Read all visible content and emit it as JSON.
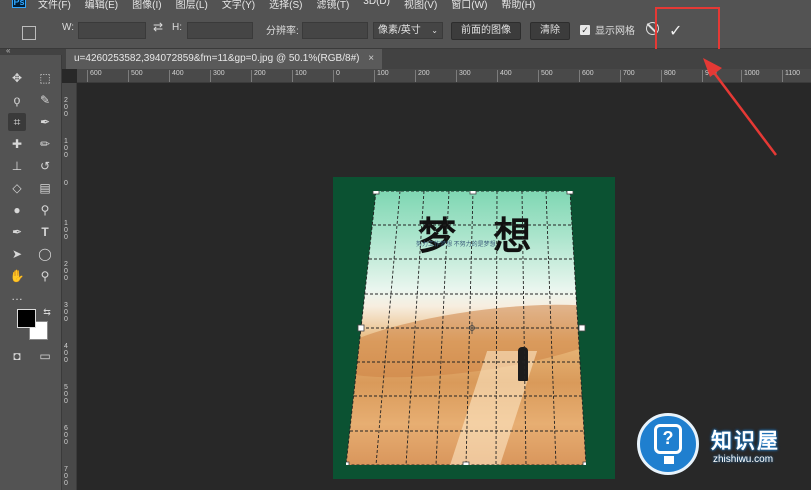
{
  "menubar": {
    "logo": "Ps",
    "items": [
      "文件(F)",
      "编辑(E)",
      "图像(I)",
      "图层(L)",
      "文字(Y)",
      "选择(S)",
      "滤镜(T)",
      "3D(D)",
      "视图(V)",
      "窗口(W)",
      "帮助(H)"
    ]
  },
  "options": {
    "w_label": "W:",
    "h_label": "H:",
    "swap_icon": "⇄",
    "resolution_label": "分辨率:",
    "unit_select": "像素/英寸",
    "front_image_button": "前面的图像",
    "clear_button": "清除",
    "show_grid_label": "显示网格",
    "show_grid_checked": true,
    "cancel_icon": "cancel-icon",
    "confirm_icon": "✓"
  },
  "document": {
    "tab_title": "u=4260253582,394072859&fm=11&gp=0.jpg @ 50.1%(RGB/8#)",
    "tab_close": "×",
    "poster_title": "梦 想",
    "poster_subtitle": "努力工作梦想   不努力的是梦想"
  },
  "rulers": {
    "horizontal": [
      "600",
      "500",
      "400",
      "300",
      "200",
      "100",
      "0",
      "100",
      "200",
      "300",
      "400",
      "500",
      "600",
      "700",
      "800",
      "900",
      "1000",
      "1100"
    ],
    "vertical": [
      "2 0 0",
      "1 0 0",
      "0",
      "1 0 0",
      "2 0 0",
      "3 0 0",
      "4 0 0",
      "5 0 0",
      "6 0 0",
      "7 0 0"
    ]
  },
  "toolbar": {
    "collapse": "«",
    "tools": [
      {
        "name": "move-tool",
        "glyph": "✥"
      },
      {
        "name": "marquee-tool",
        "glyph": "⬚"
      },
      {
        "name": "lasso-tool",
        "glyph": "ϙ"
      },
      {
        "name": "quick-select-tool",
        "glyph": "✎"
      },
      {
        "name": "crop-tool",
        "glyph": "⌗"
      },
      {
        "name": "eyedropper-tool",
        "glyph": "✒"
      },
      {
        "name": "healing-tool",
        "glyph": "✚"
      },
      {
        "name": "brush-tool",
        "glyph": "✏"
      },
      {
        "name": "stamp-tool",
        "glyph": "⊥"
      },
      {
        "name": "history-brush-tool",
        "glyph": "↺"
      },
      {
        "name": "eraser-tool",
        "glyph": "◇"
      },
      {
        "name": "gradient-tool",
        "glyph": "▤"
      },
      {
        "name": "blur-tool",
        "glyph": "●"
      },
      {
        "name": "dodge-tool",
        "glyph": "⚲"
      },
      {
        "name": "pen-tool",
        "glyph": "✒"
      },
      {
        "name": "type-tool",
        "glyph": "T"
      },
      {
        "name": "path-select-tool",
        "glyph": "➤"
      },
      {
        "name": "ellipse-tool",
        "glyph": "◯"
      },
      {
        "name": "hand-tool",
        "glyph": "✋"
      },
      {
        "name": "zoom-tool",
        "glyph": "⚲"
      },
      {
        "name": "more-tools",
        "glyph": "…"
      },
      {
        "name": "quick-mask-tool",
        "glyph": "◘"
      },
      {
        "name": "screen-mode-tool",
        "glyph": "▭"
      }
    ]
  },
  "watermark": {
    "name": "知识屋",
    "url": "zhishiwu.com",
    "accent": "#1f7fcf"
  },
  "colors": {
    "highlight": "#e53935",
    "doc_background": "#0b5232"
  }
}
